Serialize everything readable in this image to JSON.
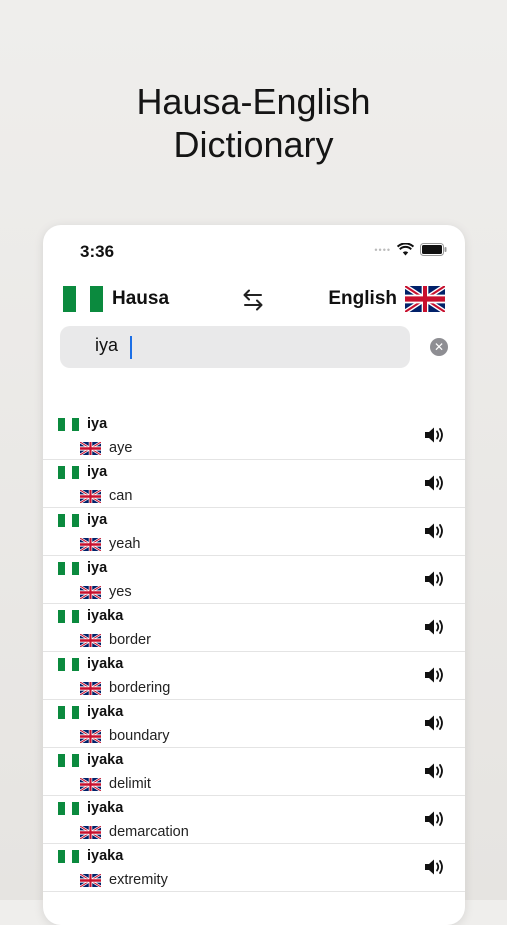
{
  "headline": {
    "line1": "Hausa-English",
    "line2": "Dictionary"
  },
  "status_bar": {
    "time": "3:36"
  },
  "languages": {
    "source": "Hausa",
    "target": "English"
  },
  "search": {
    "value": "iya",
    "placeholder": ""
  },
  "colors": {
    "nigeria_green": "#0b8a3e",
    "uk_blue": "#012169",
    "uk_red": "#c8102e",
    "caret": "#1c6fe6"
  },
  "icons": [
    "nigeria-flag-icon",
    "uk-flag-icon",
    "swap-arrows-icon",
    "clear-icon",
    "speaker-icon",
    "wifi-icon",
    "battery-icon"
  ],
  "results": [
    {
      "hausa": "iya",
      "english": "aye"
    },
    {
      "hausa": "iya",
      "english": "can"
    },
    {
      "hausa": "iya",
      "english": "yeah"
    },
    {
      "hausa": "iya",
      "english": "yes"
    },
    {
      "hausa": "iyaka",
      "english": "border"
    },
    {
      "hausa": "iyaka",
      "english": "bordering"
    },
    {
      "hausa": "iyaka",
      "english": "boundary"
    },
    {
      "hausa": "iyaka",
      "english": "delimit"
    },
    {
      "hausa": "iyaka",
      "english": "demarcation"
    },
    {
      "hausa": "iyaka",
      "english": "extremity"
    }
  ]
}
